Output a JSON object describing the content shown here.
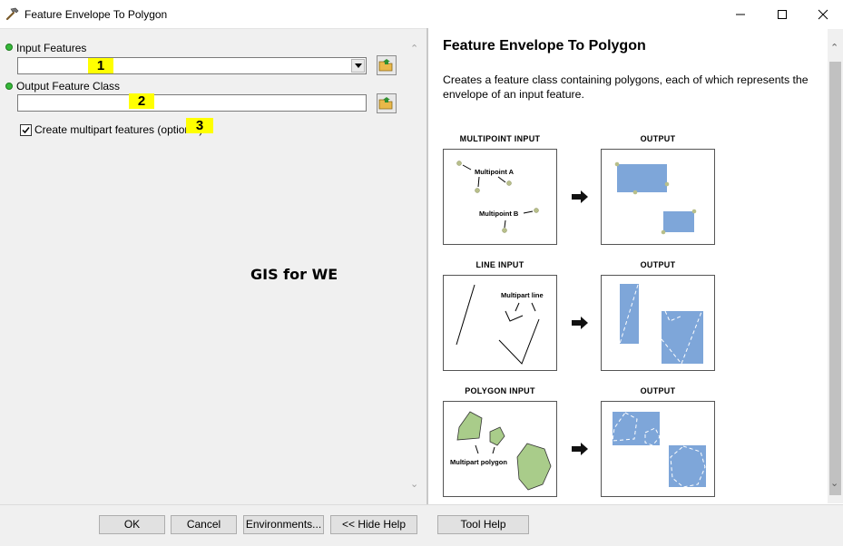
{
  "window": {
    "title": "Feature Envelope To Polygon"
  },
  "params": {
    "input_features": {
      "label": "Input Features",
      "value": "",
      "marker": "1"
    },
    "output_feature_class": {
      "label": "Output Feature Class",
      "value": "",
      "marker": "2"
    },
    "multipart": {
      "label": "Create multipart features (optional)",
      "checked": true,
      "marker": "3"
    }
  },
  "watermark": "GIS for WE",
  "help": {
    "title": "Feature Envelope To Polygon",
    "description": "Creates a feature class containing polygons, each of which represents the envelope of an input feature.",
    "diagrams": [
      {
        "input_label": "MULTIPOINT INPUT",
        "output_label": "OUTPUT",
        "notes": [
          "Multipoint A",
          "Multipoint B"
        ]
      },
      {
        "input_label": "LINE INPUT",
        "output_label": "OUTPUT",
        "notes": [
          "Multipart line"
        ]
      },
      {
        "input_label": "POLYGON INPUT",
        "output_label": "OUTPUT",
        "notes": [
          "Multipart polygon"
        ]
      }
    ]
  },
  "buttons": {
    "ok": "OK",
    "cancel": "Cancel",
    "environments": "Environments...",
    "hide_help": "<< Hide Help",
    "tool_help": "Tool Help"
  },
  "colors": {
    "envelope_fill": "#7ea6d9",
    "polygon_fill": "#a9cc8a",
    "required_dot": "#36b83a",
    "highlight": "#ffff00"
  }
}
